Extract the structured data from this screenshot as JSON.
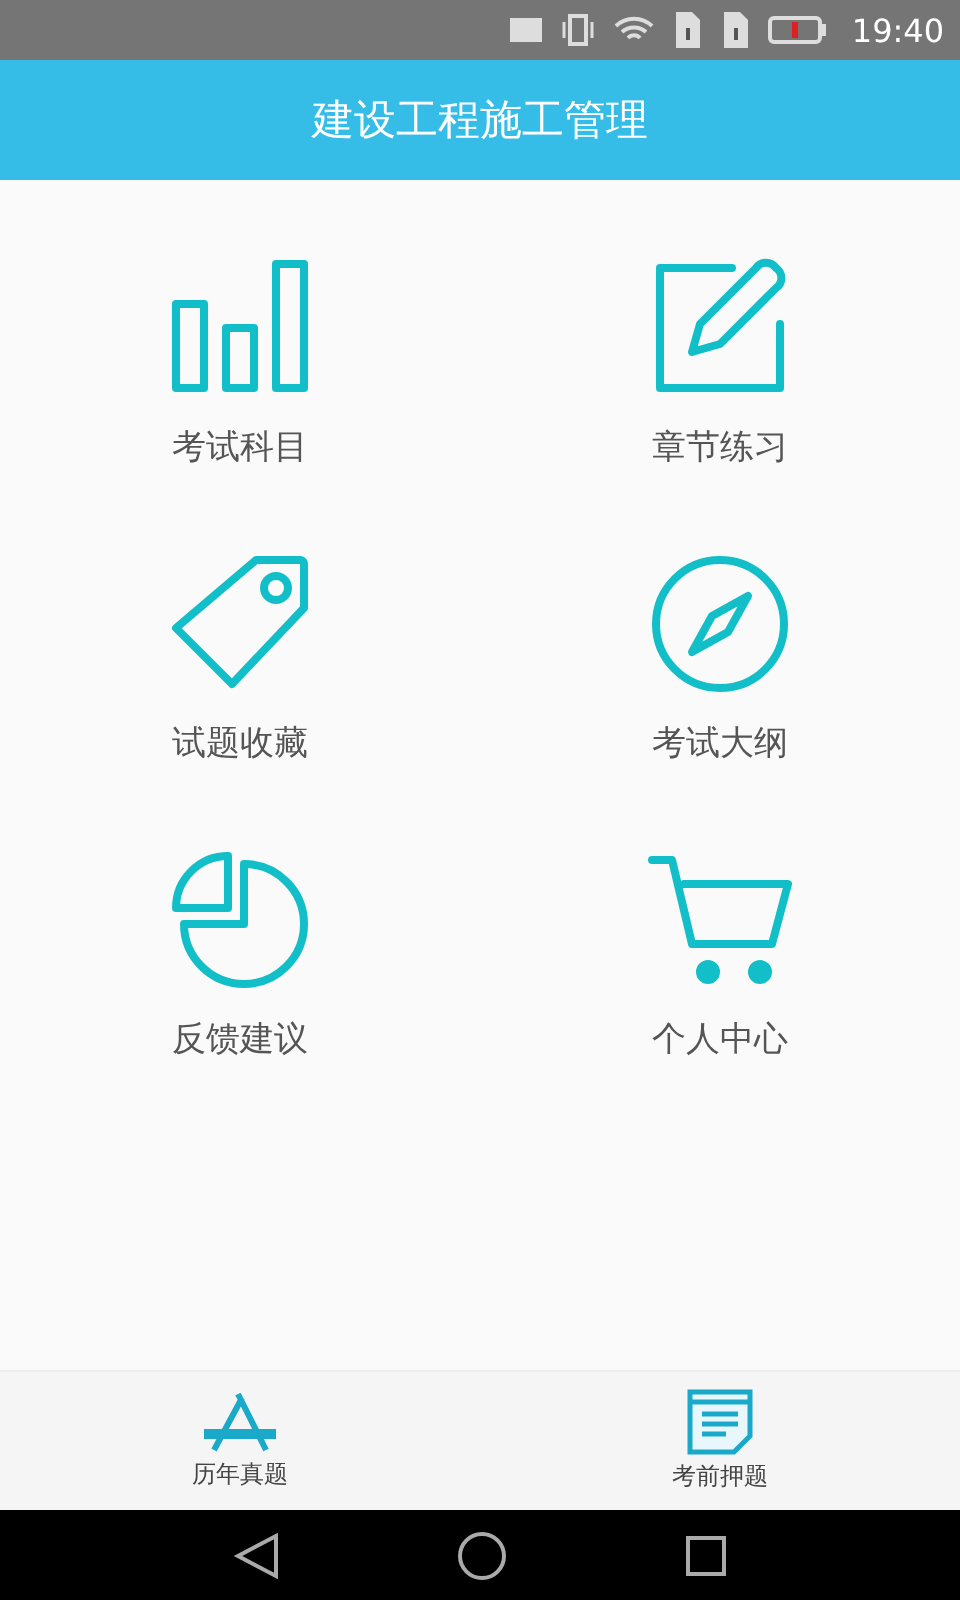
{
  "status_bar": {
    "time": "19:40"
  },
  "header": {
    "title": "建设工程施工管理"
  },
  "menu": [
    {
      "label": "考试科目"
    },
    {
      "label": "章节练习"
    },
    {
      "label": "试题收藏"
    },
    {
      "label": "考试大纲"
    },
    {
      "label": "反馈建议"
    },
    {
      "label": "个人中心"
    }
  ],
  "bottom_tabs": [
    {
      "label": "历年真题"
    },
    {
      "label": "考前押题"
    }
  ]
}
